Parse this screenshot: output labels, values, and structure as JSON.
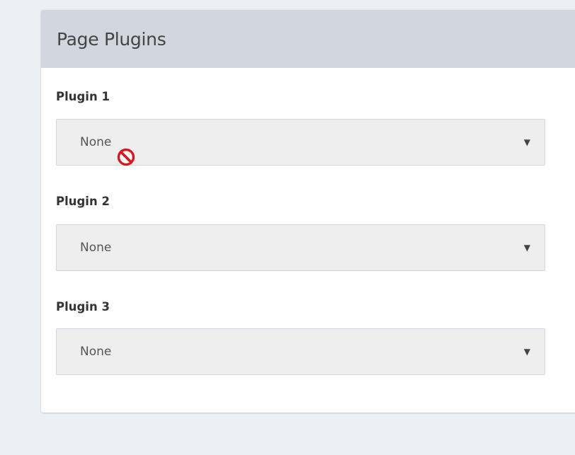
{
  "panel": {
    "title": "Page Plugins"
  },
  "fields": [
    {
      "label": "Plugin 1",
      "value": "None"
    },
    {
      "label": "Plugin 2",
      "value": "None"
    },
    {
      "label": "Plugin 3",
      "value": "None"
    }
  ],
  "select_arrow": "▼",
  "cursor": {
    "icon": "not-allowed-cursor-icon",
    "color": "#e0151b"
  },
  "colors": {
    "page_background": "#ecf0f5",
    "header_background": "#d2d6de",
    "select_background": "#eeeeee"
  }
}
